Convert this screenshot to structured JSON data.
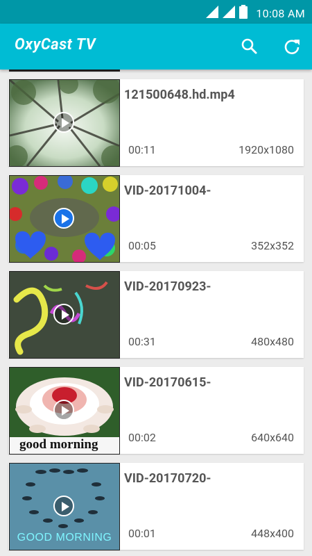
{
  "status": {
    "time": "10:08 AM"
  },
  "app": {
    "title": "OxyCast TV"
  },
  "videos": [
    {
      "title": "121500648.hd.mp4",
      "duration": "00:11",
      "resolution": "1920x1080"
    },
    {
      "title": "VID-20171004-",
      "duration": "00:05",
      "resolution": "352x352"
    },
    {
      "title": "VID-20170923-",
      "duration": "00:31",
      "resolution": "480x480"
    },
    {
      "title": "VID-20170615-",
      "duration": "00:02",
      "resolution": "640x640"
    },
    {
      "title": "VID-20170720-",
      "duration": "00:01",
      "resolution": "448x400"
    }
  ],
  "thumb_text": {
    "good_morning_lower": "good morning",
    "good_morning_upper": "GOOD MORNING"
  },
  "icons": {
    "signal": "signal-icon",
    "battery": "battery-icon",
    "search": "search-icon",
    "refresh": "refresh-icon",
    "play": "play-icon"
  },
  "colors": {
    "status_bar": "#0097a7",
    "app_bar": "#00bcd4"
  }
}
